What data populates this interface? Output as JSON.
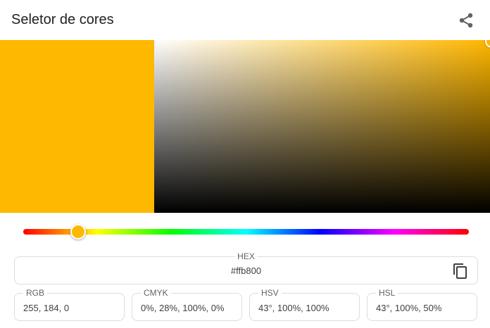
{
  "header": {
    "title": "Seletor de cores",
    "share_icon": "share-icon"
  },
  "color": {
    "current": "#ffb800",
    "hue_color": "#ffb800"
  },
  "hue_slider": {
    "hue_degrees": 43
  },
  "fields": {
    "hex": {
      "label": "HEX",
      "value": "#ffb800",
      "copy_icon": "copy-icon"
    },
    "rgb": {
      "label": "RGB",
      "value": "255, 184, 0"
    },
    "cmyk": {
      "label": "CMYK",
      "value": "0%, 28%, 100%, 0%"
    },
    "hsv": {
      "label": "HSV",
      "value": "43°, 100%, 100%"
    },
    "hsl": {
      "label": "HSL",
      "value": "43°, 100%, 50%"
    }
  }
}
